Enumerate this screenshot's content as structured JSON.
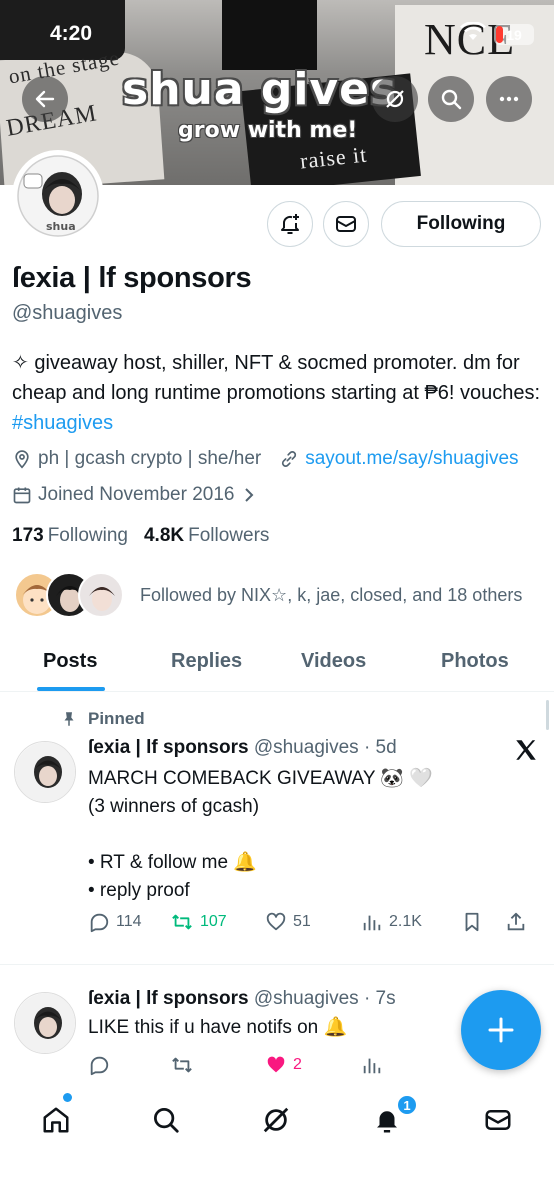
{
  "status_bar": {
    "time": "4:20",
    "battery": "19"
  },
  "banner": {
    "title": "shua gives",
    "subtitle": "grow with me!",
    "text_on_the_stage": "on the stage",
    "text_dream": "DREAM",
    "text_nce": "NCE",
    "text_raise": "raise it"
  },
  "profile": {
    "display_name": "ſexia | lf sponsors",
    "handle": "@shuagives",
    "bio_text": "✧ giveaway host, shiller, NFT & socmed promoter. dm for cheap and long runtime promotions starting at ₱6! vouches: ",
    "bio_hashtag": "#shuagives",
    "location": "ph | gcash crypto | she/her",
    "website": "sayout.me/say/shuagives",
    "joined": "Joined November 2016",
    "following_count": "173",
    "following_label": "Following",
    "followers_count": "4.8K",
    "followers_label": "Followers",
    "followed_by": "Followed by NIX☆, k, jae, closed, and 18 others",
    "following_button": "Following",
    "avatar_label": "shua"
  },
  "tabs": [
    {
      "label": "Posts",
      "active": true
    },
    {
      "label": "Replies",
      "active": false
    },
    {
      "label": "Videos",
      "active": false
    },
    {
      "label": "Photos",
      "active": false
    }
  ],
  "posts": [
    {
      "pinned_label": "Pinned",
      "name": "ſexia | lf sponsors",
      "handle": "@shuagives",
      "time": "· 5d",
      "lines": [
        "MARCH COMEBACK GIVEAWAY 🐼 🤍",
        "(3 winners of gcash)",
        "",
        "• RT & follow me 🔔",
        "• reply proof"
      ],
      "replies": "114",
      "reposts": "107",
      "likes": "51",
      "views": "2.1K"
    },
    {
      "name": "ſexia | lf sponsors",
      "handle": "@shuagives",
      "time": "· 7s",
      "lines": [
        "LIKE this if u have notifs on 🔔"
      ],
      "likes": "2"
    }
  ],
  "bottom_nav": {
    "notifications_badge": "1"
  },
  "colors": {
    "accent": "#1d9bf0",
    "repost_green": "#00ba7c",
    "like_pink": "#f91880",
    "secondary_text": "#536471"
  }
}
